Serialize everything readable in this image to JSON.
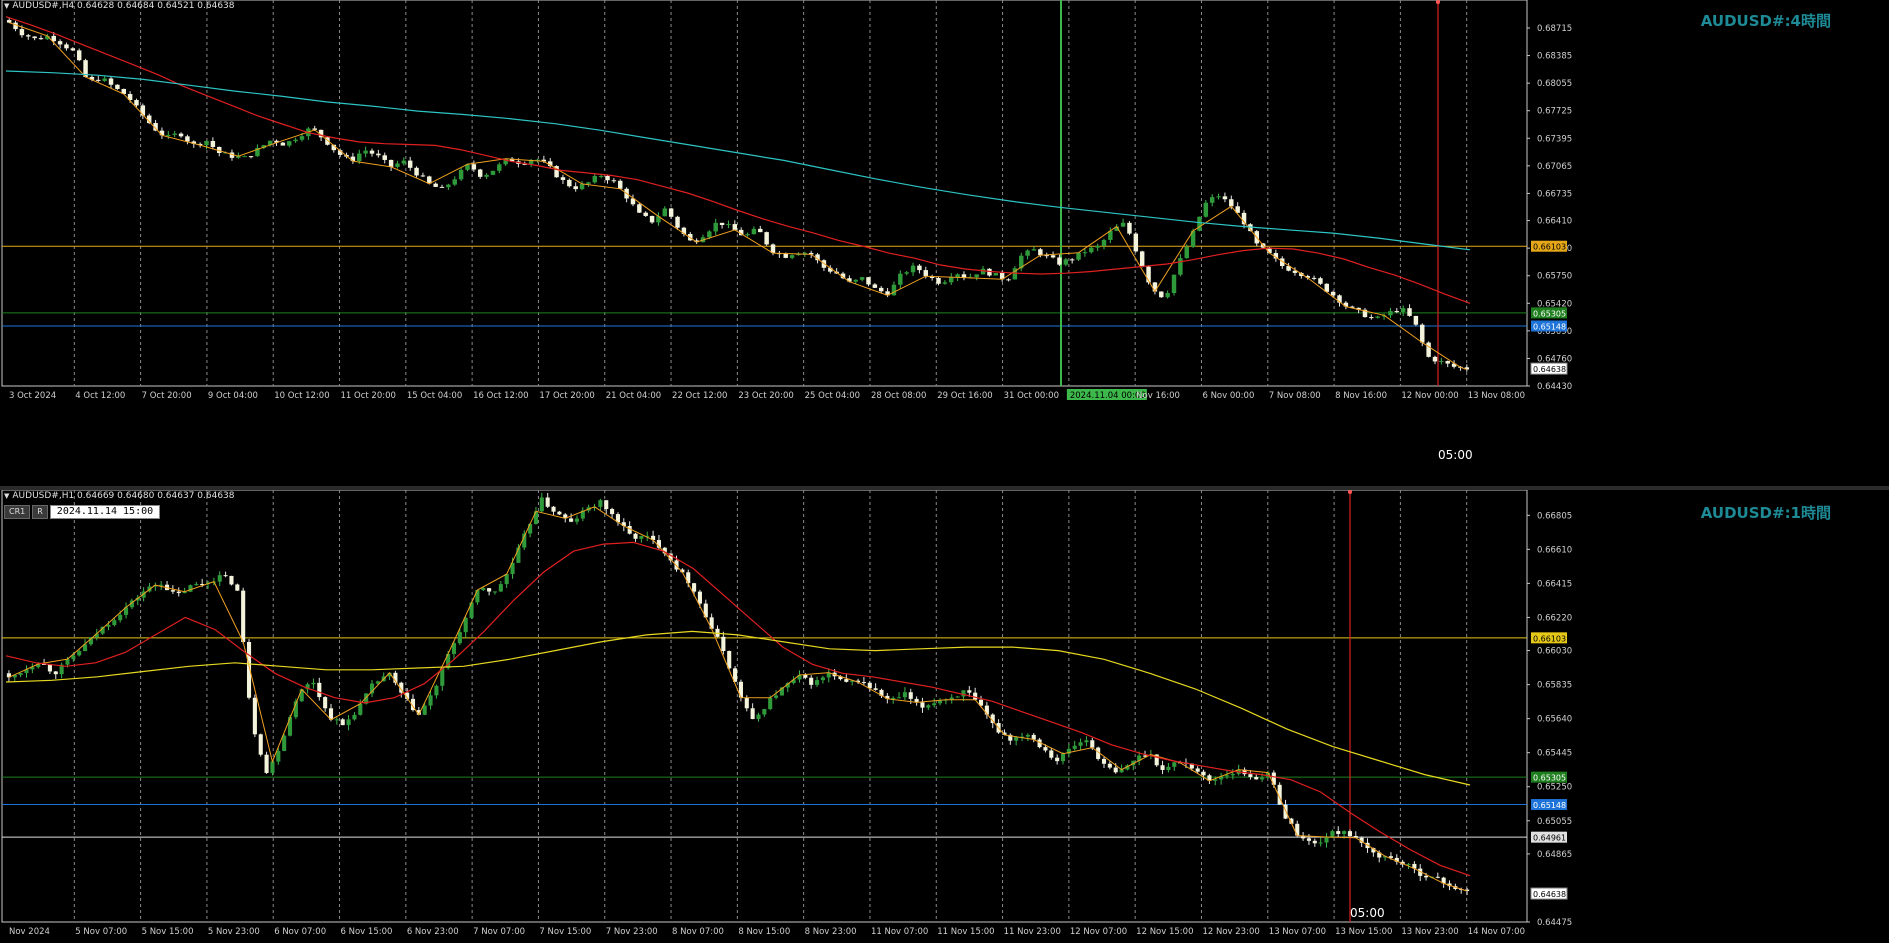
{
  "chart_data": [
    {
      "type": "candlestick",
      "symbol": "AUDUSD#,H4",
      "header": "AUDUSD#,H4  0.64628 0.64684 0.64521 0.64638",
      "ohlc": {
        "open": "0.64628",
        "high": "0.64684",
        "low": "0.64521",
        "close": "0.64638"
      },
      "watermark": "AUDUSD#:4時間",
      "ylim": [
        0.6443,
        0.6905
      ],
      "y_ticks": [
        "0.68715",
        "0.68385",
        "0.68055",
        "0.67725",
        "0.67395",
        "0.67065",
        "0.66735",
        "0.66410",
        "0.66080",
        "0.65750",
        "0.65420",
        "0.65090",
        "0.64760",
        "0.64430"
      ],
      "x_ticks": [
        "3 Oct 2024",
        "4 Oct 12:00",
        "7 Oct 20:00",
        "9 Oct 04:00",
        "10 Oct 12:00",
        "11 Oct 20:00",
        "15 Oct 04:00",
        "16 Oct 12:00",
        "17 Oct 20:00",
        "21 Oct 04:00",
        "22 Oct 12:00",
        "23 Oct 20:00",
        "25 Oct 04:00",
        "28 Oct 08:00",
        "29 Oct 16:00",
        "31 Oct 00:00",
        "2024.11.04 00:00",
        "Nov 16:00",
        "6 Nov 00:00",
        "7 Nov 08:00",
        "8 Nov 16:00",
        "12 Nov 00:00",
        "13 Nov 08:00"
      ],
      "close_path": [
        0.6878,
        0.6865,
        0.6858,
        0.6862,
        0.6853,
        0.6842,
        0.6806,
        0.6812,
        0.68,
        0.679,
        0.677,
        0.6752,
        0.674,
        0.6746,
        0.6731,
        0.6737,
        0.6722,
        0.6718,
        0.6716,
        0.6727,
        0.6738,
        0.6732,
        0.6742,
        0.6752,
        0.6738,
        0.6722,
        0.6712,
        0.6726,
        0.6719,
        0.6705,
        0.6712,
        0.6698,
        0.6684,
        0.6678,
        0.6693,
        0.6708,
        0.6694,
        0.6703,
        0.6715,
        0.671,
        0.6716,
        0.6707,
        0.669,
        0.668,
        0.6685,
        0.6696,
        0.6688,
        0.667,
        0.6648,
        0.664,
        0.6656,
        0.6631,
        0.6614,
        0.6626,
        0.664,
        0.6632,
        0.6622,
        0.6631,
        0.6606,
        0.6598,
        0.6604,
        0.6602,
        0.6585,
        0.6578,
        0.6566,
        0.6572,
        0.6558,
        0.6554,
        0.6578,
        0.6586,
        0.6574,
        0.6566,
        0.658,
        0.6572,
        0.6582,
        0.6576,
        0.657,
        0.6598,
        0.6606,
        0.6598,
        0.659,
        0.6596,
        0.6605,
        0.661,
        0.663,
        0.6638,
        0.6598,
        0.656,
        0.6548,
        0.6588,
        0.662,
        0.666,
        0.6672,
        0.666,
        0.664,
        0.6612,
        0.66,
        0.6586,
        0.658,
        0.6574,
        0.6562,
        0.655,
        0.6536,
        0.653,
        0.6522,
        0.653,
        0.6536,
        0.652,
        0.6478,
        0.6472,
        0.6466,
        0.6464
      ],
      "ma_red": [
        0.6885,
        0.6875,
        0.6864,
        0.6852,
        0.684,
        0.6828,
        0.6816,
        0.6802,
        0.679,
        0.6778,
        0.6766,
        0.6756,
        0.6746,
        0.674,
        0.6735,
        0.6733,
        0.6732,
        0.6731,
        0.6726,
        0.6719,
        0.6712,
        0.6707,
        0.6701,
        0.6698,
        0.6695,
        0.669,
        0.6682,
        0.6674,
        0.6664,
        0.6653,
        0.6643,
        0.6634,
        0.6626,
        0.6617,
        0.661,
        0.6602,
        0.6596,
        0.6588,
        0.6583,
        0.658,
        0.6578,
        0.6577,
        0.6578,
        0.658,
        0.6583,
        0.6586,
        0.6589,
        0.6594,
        0.66,
        0.6605,
        0.6608,
        0.6607,
        0.6602,
        0.6595,
        0.6585,
        0.6576,
        0.6565,
        0.6553,
        0.6542
      ],
      "ma_cyan": [
        0.682,
        0.6818,
        0.6815,
        0.681,
        0.6803,
        0.6796,
        0.679,
        0.6783,
        0.6778,
        0.6772,
        0.6768,
        0.6763,
        0.6757,
        0.6749,
        0.674,
        0.6731,
        0.6722,
        0.6713,
        0.6702,
        0.6691,
        0.6681,
        0.6672,
        0.6664,
        0.6657,
        0.6651,
        0.6645,
        0.6639,
        0.6634,
        0.663,
        0.6626,
        0.662,
        0.6613,
        0.6606
      ],
      "hlines": [
        {
          "label": "0.66103",
          "value": 0.66103,
          "color": "#e6a817"
        },
        {
          "label": "0.65305",
          "value": 0.65305,
          "color": "#1f7f1f"
        },
        {
          "label": "0.65148",
          "value": 0.65148,
          "color": "#1e73d8"
        },
        {
          "label": "0.64638",
          "value": 0.64638,
          "color": "#c0c0c0"
        }
      ],
      "vlines": [
        {
          "name": "2024.11.04 00:00",
          "color": "#3db84a"
        },
        {
          "name": "current-time",
          "color": "#d42020"
        }
      ],
      "timer": "05:00"
    },
    {
      "type": "candlestick",
      "symbol": "AUDUSD#,H1",
      "header": "AUDUSD#,H1  0.64669 0.64680 0.64637 0.64638",
      "ohlc": {
        "open": "0.64669",
        "high": "0.64680",
        "low": "0.64637",
        "close": "0.64638"
      },
      "watermark": "AUDUSD#:1時間",
      "buttons": [
        "CR1",
        "R"
      ],
      "date_field": "2024.11.14 15:00",
      "ylim": [
        0.64475,
        0.6695
      ],
      "y_ticks": [
        "0.66805",
        "0.66610",
        "0.66415",
        "0.66220",
        "0.66030",
        "0.65835",
        "0.65640",
        "0.65445",
        "0.65250",
        "0.65055",
        "0.64865",
        "0.64475"
      ],
      "x_ticks": [
        "Nov 2024",
        "5 Nov 07:00",
        "5 Nov 15:00",
        "5 Nov 23:00",
        "6 Nov 07:00",
        "6 Nov 15:00",
        "6 Nov 23:00",
        "7 Nov 07:00",
        "7 Nov 15:00",
        "7 Nov 23:00",
        "8 Nov 07:00",
        "8 Nov 15:00",
        "8 Nov 23:00",
        "11 Nov 07:00",
        "11 Nov 15:00",
        "11 Nov 23:00",
        "12 Nov 07:00",
        "12 Nov 15:00",
        "12 Nov 23:00",
        "13 Nov 07:00",
        "13 Nov 15:00",
        "13 Nov 23:00",
        "14 Nov 07:00"
      ],
      "close_path": [
        0.6587,
        0.6592,
        0.6597,
        0.659,
        0.6598,
        0.6606,
        0.6615,
        0.6622,
        0.663,
        0.6638,
        0.6642,
        0.6634,
        0.664,
        0.6642,
        0.6646,
        0.664,
        0.6562,
        0.6532,
        0.6552,
        0.6578,
        0.6586,
        0.6566,
        0.656,
        0.657,
        0.6584,
        0.659,
        0.6576,
        0.6566,
        0.658,
        0.6602,
        0.662,
        0.664,
        0.6636,
        0.665,
        0.667,
        0.669,
        0.6682,
        0.6676,
        0.6684,
        0.6688,
        0.6678,
        0.6668,
        0.6668,
        0.6662,
        0.665,
        0.664,
        0.662,
        0.6604,
        0.658,
        0.6562,
        0.6574,
        0.6582,
        0.6588,
        0.6584,
        0.659,
        0.6584,
        0.6586,
        0.658,
        0.6574,
        0.6578,
        0.657,
        0.6574,
        0.6576,
        0.658,
        0.657,
        0.6558,
        0.6552,
        0.6556,
        0.6548,
        0.654,
        0.6548,
        0.6552,
        0.6538,
        0.6532,
        0.654,
        0.6545,
        0.6534,
        0.654,
        0.6536,
        0.6528,
        0.6532,
        0.6534,
        0.653,
        0.6532,
        0.6508,
        0.6496,
        0.6492,
        0.6498,
        0.65,
        0.6492,
        0.6486,
        0.6484,
        0.648,
        0.6475,
        0.6472,
        0.6468,
        0.6464
      ],
      "ma_red": [
        0.66,
        0.6596,
        0.6594,
        0.6596,
        0.6602,
        0.6612,
        0.6622,
        0.6615,
        0.6602,
        0.659,
        0.6582,
        0.6576,
        0.6573,
        0.6576,
        0.6584,
        0.6598,
        0.6614,
        0.6632,
        0.6648,
        0.666,
        0.6664,
        0.6665,
        0.666,
        0.665,
        0.6635,
        0.662,
        0.6605,
        0.6595,
        0.659,
        0.6588,
        0.6585,
        0.6582,
        0.6578,
        0.6574,
        0.6568,
        0.6562,
        0.6556,
        0.6549,
        0.6544,
        0.654,
        0.6537,
        0.6534,
        0.6532,
        0.6529,
        0.6522,
        0.651,
        0.6499,
        0.6489,
        0.648,
        0.6474
      ],
      "ma_yellow": [
        0.6585,
        0.6586,
        0.6588,
        0.6591,
        0.6594,
        0.6596,
        0.6594,
        0.6592,
        0.6592,
        0.6593,
        0.6594,
        0.6598,
        0.6603,
        0.6608,
        0.6612,
        0.6614,
        0.6612,
        0.6608,
        0.6604,
        0.6603,
        0.6604,
        0.6605,
        0.6605,
        0.6603,
        0.6598,
        0.659,
        0.6581,
        0.657,
        0.6558,
        0.6548,
        0.654,
        0.6532,
        0.6526
      ],
      "hlines": [
        {
          "label": "0.66103",
          "value": 0.66103,
          "color": "#e6c817"
        },
        {
          "label": "0.65305",
          "value": 0.65305,
          "color": "#1f7f1f"
        },
        {
          "label": "0.65148",
          "value": 0.65148,
          "color": "#1e73d8"
        },
        {
          "label": "0.64961",
          "value": 0.64961,
          "color": "#e0e0e0"
        },
        {
          "label": "0.64638",
          "value": 0.64638,
          "color": "#c0c0c0"
        }
      ],
      "vlines": [
        {
          "name": "current-time",
          "color": "#d42020"
        }
      ],
      "timer": "05:00"
    }
  ]
}
